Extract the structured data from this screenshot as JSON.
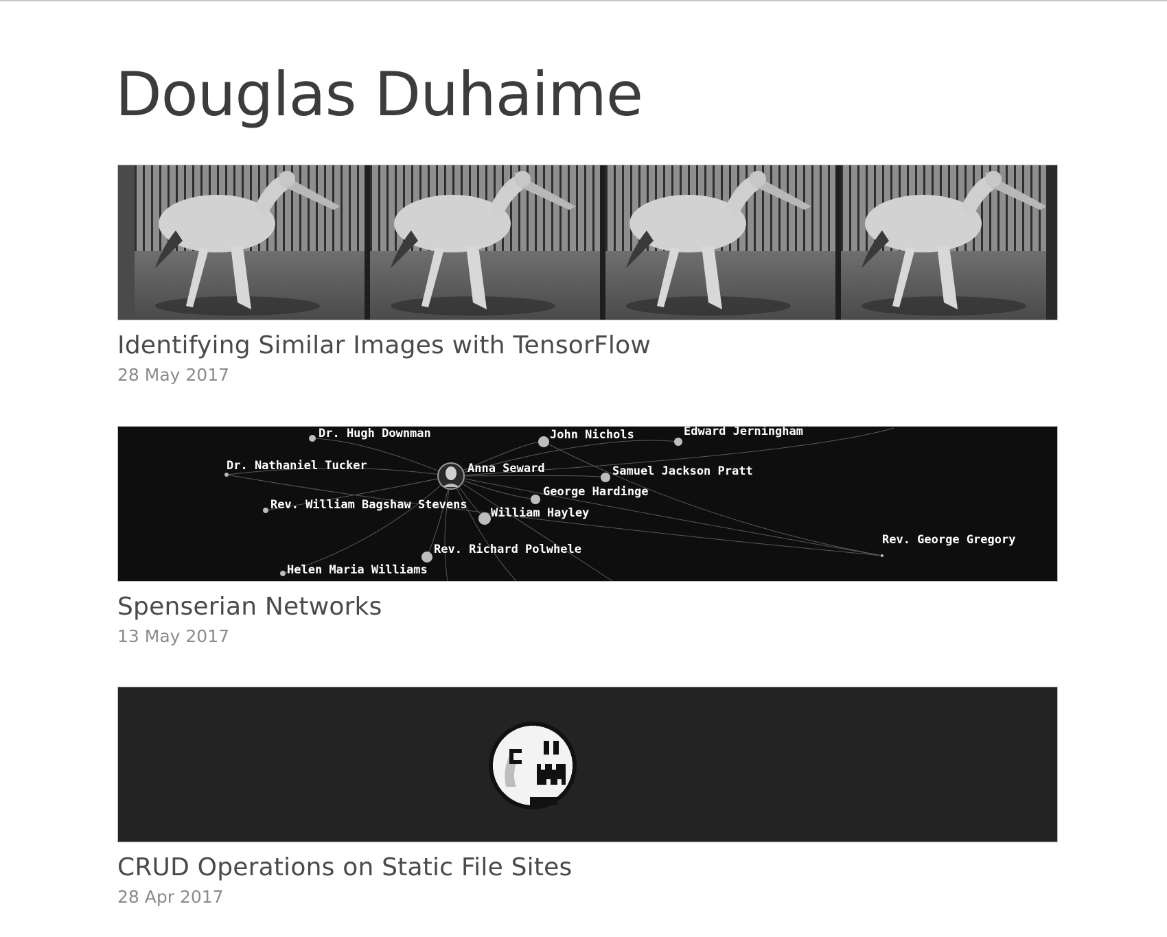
{
  "site": {
    "title": "Douglas Duhaime"
  },
  "posts": [
    {
      "title": "Identifying Similar Images with TensorFlow",
      "date": "28 May 2017",
      "image_icon": "photo-strip-stork-walking"
    },
    {
      "title": "Spenserian Networks",
      "date": "13 May 2017",
      "image_icon": "network-graph",
      "network_labels": [
        "Dr. Hugh Downman",
        "John Nichols",
        "Edward Jerningham",
        "Dr. Nathaniel Tucker",
        "Anna Seward",
        "Samuel Jackson Pratt",
        "George Hardinge",
        "Rev. William Bagshaw Stevens",
        "William Hayley",
        "Rev. George Gregory",
        "Rev. Richard Polwhele",
        "Helen Maria Williams"
      ]
    },
    {
      "title": "CRUD Operations on Static File Sites",
      "date": "28 Apr 2017",
      "image_icon": "pixel-ghost-boo"
    }
  ],
  "colors": {
    "text": "#3e3e3e",
    "date": "#8a8a8a",
    "network_bg": "#0e0e0e",
    "crud_bg": "#232323"
  }
}
